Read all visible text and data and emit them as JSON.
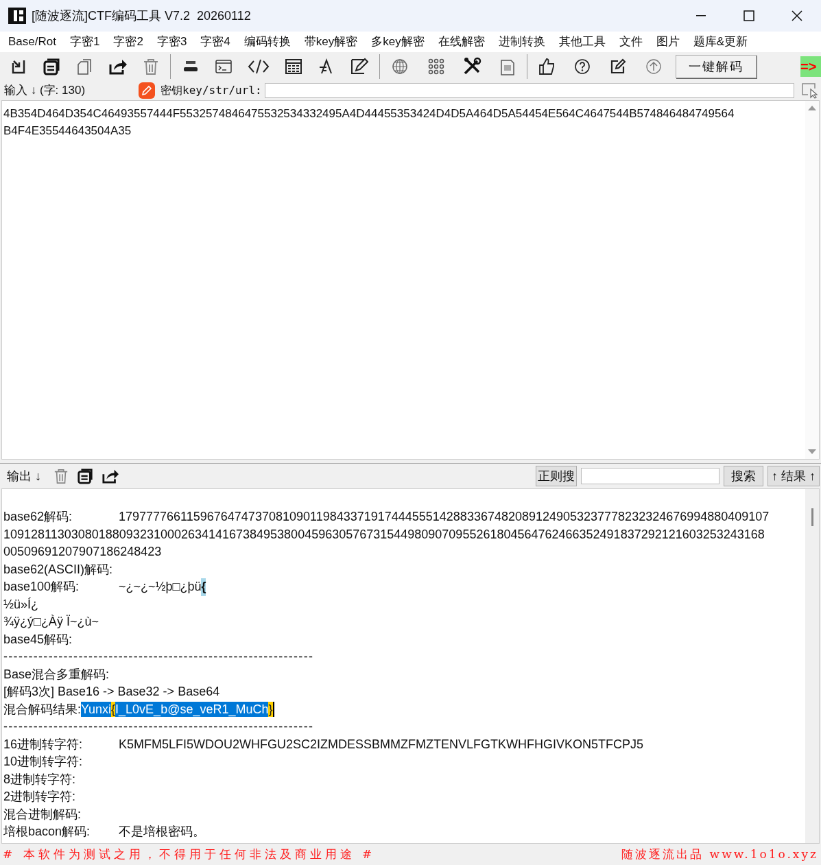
{
  "window": {
    "title": "[随波逐流]CTF编码工具 V7.2  20260112"
  },
  "menu": [
    "Base/Rot",
    "字密1",
    "字密2",
    "字密3",
    "字密4",
    "编码转换",
    "带key解密",
    "多key解密",
    "在线解密",
    "进制转换",
    "其他工具",
    "文件",
    "图片",
    "题库&更新"
  ],
  "toolbar": {
    "decode_button": "一键解码",
    "arrow": "=>"
  },
  "input": {
    "label": "输入 ↓ (字: 130)",
    "key_label": "密钥key/str/url:",
    "lines": [
      "4B354D464D354C46493557444F5532574846475532534332495A4D44455353424D4D5A464D5A54454E564C4647544B574846484749564",
      "B4F4E35544643504A35"
    ]
  },
  "output": {
    "label": "输出 ↓",
    "regex_button": "正则搜",
    "search_button": "搜索",
    "result_button": "↑ 结果 ↑",
    "lines": [
      {
        "kind": "pair",
        "label": "base62解码:",
        "value": "17977776611596764747370810901198433719174445551428833674820891249053237778232324676994880409107"
      },
      {
        "kind": "text",
        "text": "109128113030801880932310002634141673849538004596305767315449809070955261804564762466352491837292121603253243168"
      },
      {
        "kind": "text",
        "text": "00509691207907186248423"
      },
      {
        "kind": "pair",
        "label": "base62(ASCII)解码:"
      },
      {
        "kind": "pair",
        "label": "base100解码:",
        "value": "~¿~¿~½þ□¿þü",
        "mark": "{"
      },
      {
        "kind": "text",
        "text": "½ü»Í¿"
      },
      {
        "kind": "text",
        "text": "¾ÿ¿ý□¿Àÿ Ï~¿ù~"
      },
      {
        "kind": "pair",
        "label": "base45解码:"
      },
      {
        "kind": "rule",
        "text": "--------------------------------------------------------------"
      },
      {
        "kind": "text",
        "text": "Base混合多重解码:"
      },
      {
        "kind": "text",
        "text": "[解码3次] Base16 -> Base32 -> Base64"
      },
      {
        "kind": "result",
        "label": "混合解码结果:",
        "parts": [
          {
            "text": "Yunxi",
            "brace": false
          },
          {
            "text": "{",
            "brace": true
          },
          {
            "text": "I_L0vE_b@se_veR1_MuCh",
            "brace": false
          },
          {
            "text": "}",
            "brace": true
          }
        ]
      },
      {
        "kind": "rule",
        "text": "--------------------------------------------------------------"
      },
      {
        "kind": "pair",
        "label": "16进制转字符:",
        "value": "K5MFM5LFI5WDOU2WHFGU2SC2IZMDESSBMMZFMZTENVLFGTKWHFHGIVKON5TFCPJ5"
      },
      {
        "kind": "pair",
        "label": "10进制转字符:"
      },
      {
        "kind": "pair",
        "label": "8进制转字符:"
      },
      {
        "kind": "pair",
        "label": "2进制转字符:"
      },
      {
        "kind": "pair",
        "label": "混合进制解码:"
      },
      {
        "kind": "pair",
        "label": "培根bacon解码:",
        "value": "不是培根密码。"
      }
    ]
  },
  "footer": {
    "left": "# 本软件为测试之用，不得用于任何非法及商业用途 #",
    "right": "随波逐流出品 www.1o1o.xyz"
  }
}
